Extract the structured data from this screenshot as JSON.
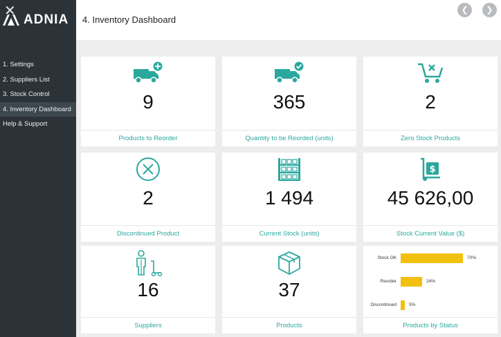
{
  "app": {
    "brand": "ADNIA"
  },
  "header": {
    "title": "4. Inventory Dashboard"
  },
  "sidebar": {
    "items": [
      {
        "label": "1. Settings"
      },
      {
        "label": "2. Suppliers List"
      },
      {
        "label": "3. Stock Control"
      },
      {
        "label": "4. Inventory Dashboard",
        "active": true
      },
      {
        "label": "Help & Support"
      }
    ]
  },
  "cards": {
    "reorder": {
      "value": "9",
      "label": "Products to Reorder",
      "icon": "truck-plus-icon"
    },
    "qty_reorder": {
      "value": "365",
      "label": "Quantity to be Reorded (units)",
      "icon": "truck-check-icon"
    },
    "zero_stock": {
      "value": "2",
      "label": "Zero Stock Products",
      "icon": "cart-x-icon"
    },
    "discontinued": {
      "value": "2",
      "label": "Discontinued Product",
      "icon": "circle-x-icon"
    },
    "current_stock": {
      "value": "1 494",
      "label": "Current Stock (units)",
      "icon": "shelves-icon"
    },
    "stock_value": {
      "value": "45 626,00",
      "label": "Stock Current Value ($)",
      "icon": "dollar-trolley-icon"
    },
    "suppliers": {
      "value": "16",
      "label": "Suppliers",
      "icon": "person-trolley-icon"
    },
    "products": {
      "value": "37",
      "label": "Products",
      "icon": "box-icon"
    },
    "by_status": {
      "label": "Products by Status"
    }
  },
  "colors": {
    "accent": "#2aa89e",
    "bar": "#f2c10f",
    "sidebar": "#2b3338"
  },
  "chart_data": {
    "type": "bar",
    "orientation": "horizontal",
    "categories": [
      "Stock OK",
      "Reorder",
      "Discontinued"
    ],
    "values": [
      70,
      24,
      5
    ],
    "value_labels": [
      "70%",
      "24%",
      "5%"
    ],
    "xlim": [
      0,
      100
    ],
    "grid": false
  }
}
